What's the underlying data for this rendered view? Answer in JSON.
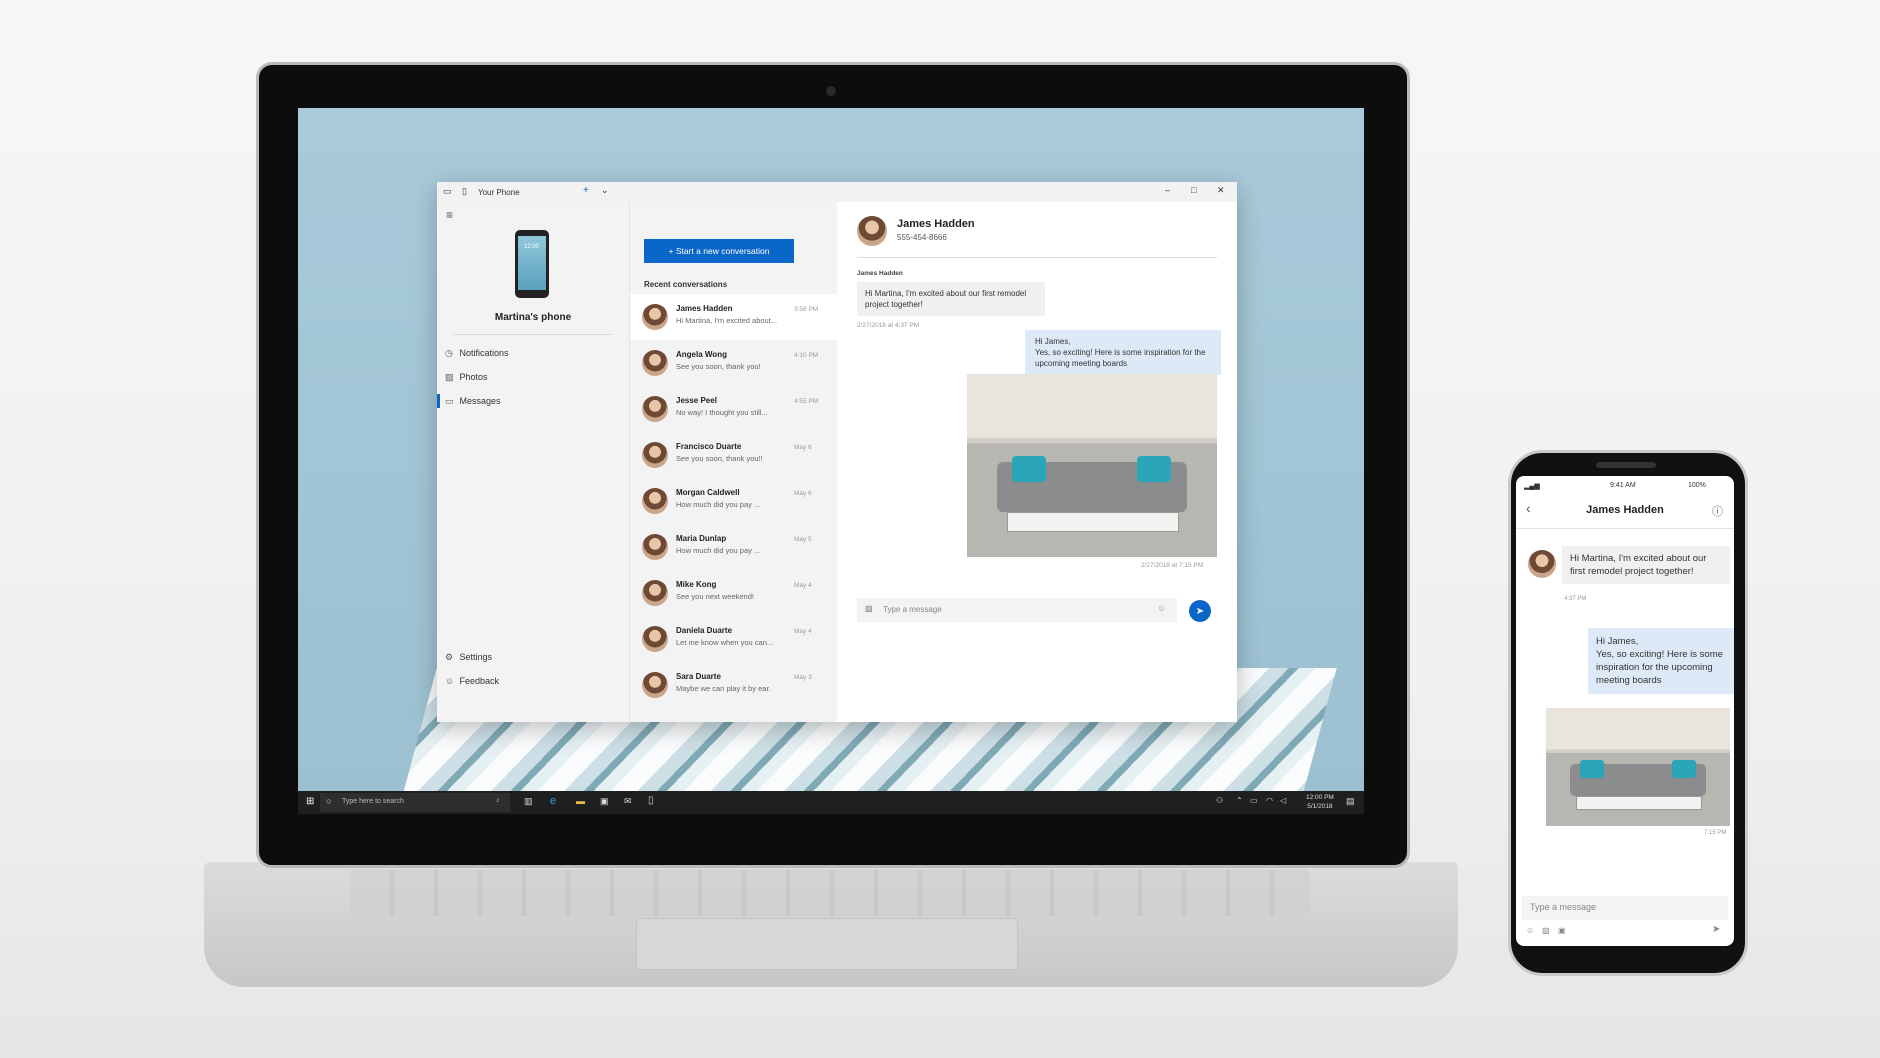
{
  "window": {
    "title": "Your Phone",
    "add_tab": "+",
    "tab_menu": "⌄",
    "minimize": "–",
    "maximize": "□",
    "close": "✕"
  },
  "left": {
    "menu_icon": "≡",
    "phone_name": "Martina's phone",
    "phone_time": "12:00",
    "nav": [
      {
        "label": "Notifications",
        "icon": "clock-icon"
      },
      {
        "label": "Photos",
        "icon": "photo-icon"
      },
      {
        "label": "Messages",
        "icon": "chat-icon"
      }
    ],
    "bottom": [
      {
        "label": "Settings",
        "icon": "gear-icon"
      },
      {
        "label": "Feedback",
        "icon": "feedback-icon"
      }
    ]
  },
  "conversations": {
    "new_button": "+   Start a new conversation",
    "recent_label": "Recent conversations",
    "items": [
      {
        "name": "James Hadden",
        "preview": "Hi Martina, I'm excited about...",
        "time": "3:58 PM"
      },
      {
        "name": "Angela Wong",
        "preview": "See you soon, thank you!",
        "time": "4:10 PM"
      },
      {
        "name": "Jesse Peel",
        "preview": "No way! I thought you still...",
        "time": "4:55 PM"
      },
      {
        "name": "Francisco Duarte",
        "preview": "See you soon, thank you!!",
        "time": "May 6"
      },
      {
        "name": "Morgan Caldwell",
        "preview": "How much did you pay ...",
        "time": "May 6"
      },
      {
        "name": "Maria Dunlap",
        "preview": "How much did you pay ...",
        "time": "May 5"
      },
      {
        "name": "Mike Kong",
        "preview": "See you next weekend!",
        "time": "May 4"
      },
      {
        "name": "Daniela Duarte",
        "preview": "Let me know when you can...",
        "time": "May 4"
      },
      {
        "name": "Sara Duarte",
        "preview": "Maybe we can play it by ear.",
        "time": "May 3"
      }
    ]
  },
  "chat": {
    "contact_name": "James Hadden",
    "contact_phone": "555-454-8666",
    "sender_label": "James Hadden",
    "incoming": "Hi Martina, I'm excited about our first remodel project together!",
    "incoming_time": "2/27/2018 at 4:37 PM",
    "outgoing_line1": "Hi James,",
    "outgoing_line2": "Yes, so exciting! Here is some inspiration for the upcoming meeting boards",
    "outgoing_time": "2/27/2018 at 7:15 PM",
    "input_placeholder": "Type a message",
    "send_icon": "send-icon"
  },
  "taskbar": {
    "search_placeholder": "Type here to search",
    "time": "12:00 PM",
    "date": "5/1/2018"
  },
  "phone": {
    "status_time": "9:41 AM",
    "battery": "100%",
    "title": "James Hadden",
    "incoming": "Hi Martina, I'm excited about our first remodel project together!",
    "incoming_time": "4:37 PM",
    "outgoing_line1": "Hi James,",
    "outgoing_line2": "Yes, so exciting! Here is some inspiration for the upcoming meeting boards",
    "outgoing_time": "7:15 PM",
    "input_placeholder": "Type a message"
  }
}
